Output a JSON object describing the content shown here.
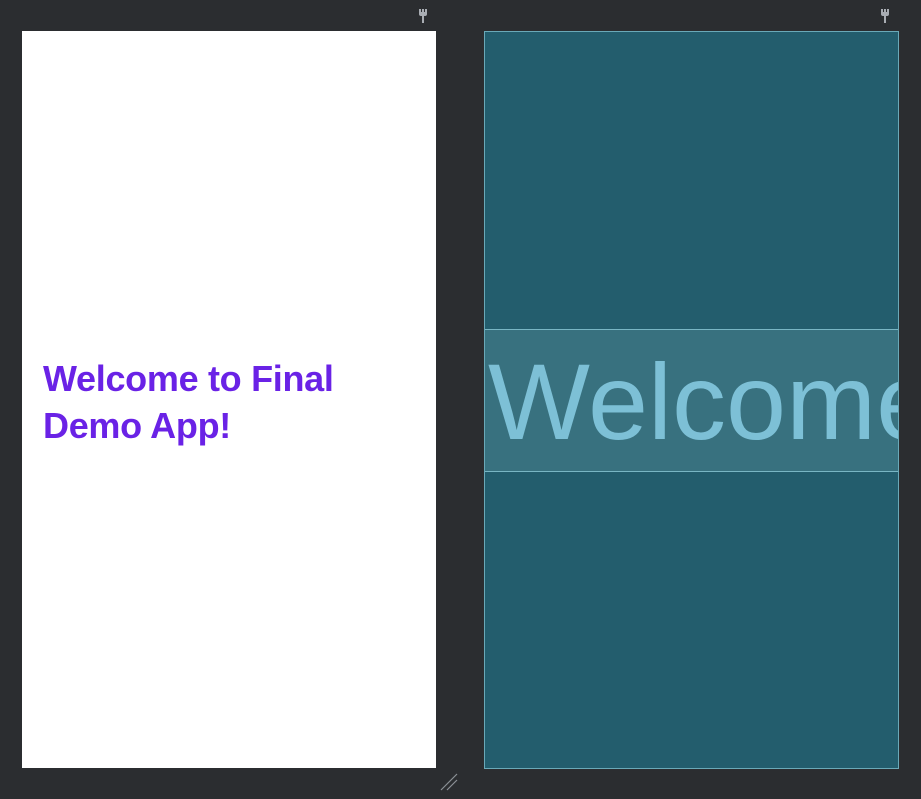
{
  "design": {
    "welcome_text": "Welcome to Final Demo App!",
    "text_color": "#6a22e6",
    "background": "#ffffff",
    "pin_icon": "pin-icon"
  },
  "blueprint": {
    "textview_label": "Welcome",
    "background": "#235d6d",
    "textview_background": "#38717f",
    "text_color": "#7dc0d6",
    "pin_icon": "pin-icon"
  },
  "editor": {
    "background": "#2b2d30",
    "resize_icon": "resize-handle-icon"
  }
}
